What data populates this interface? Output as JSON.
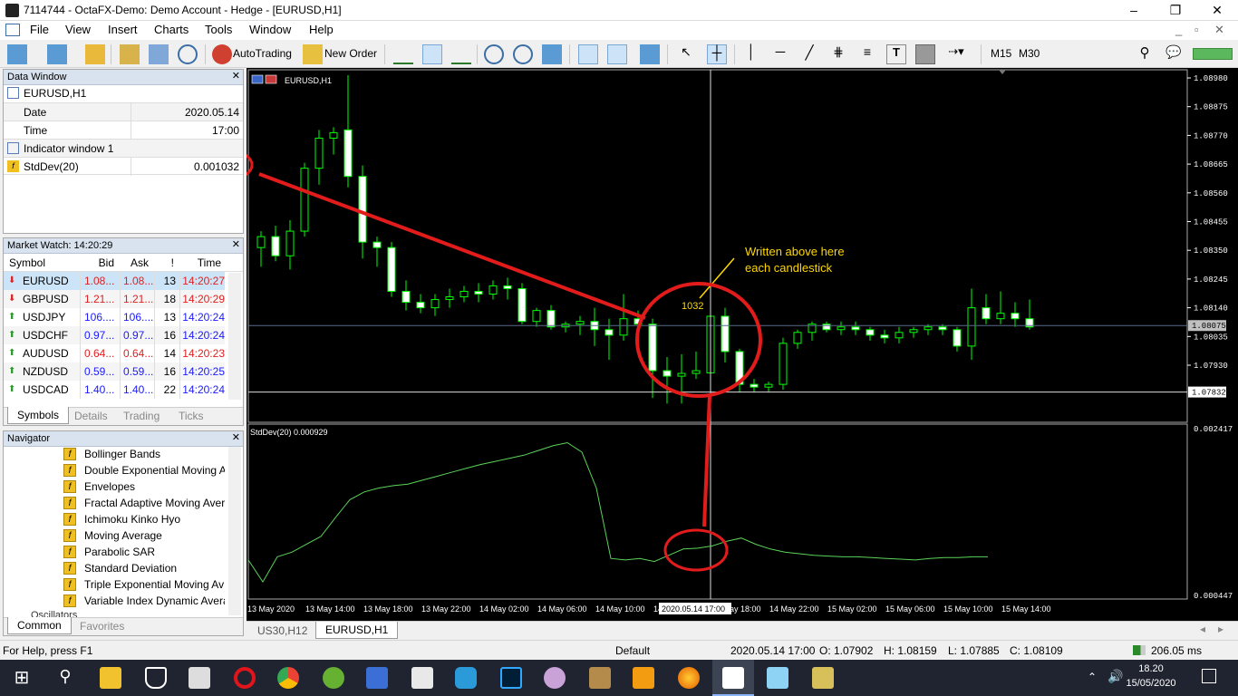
{
  "window": {
    "title": "7114744 - OctaFX-Demo: Demo Account - Hedge - [EURUSD,H1]",
    "min": "–",
    "max": "❐",
    "close": "✕"
  },
  "menu": [
    "File",
    "View",
    "Insert",
    "Charts",
    "Tools",
    "Window",
    "Help"
  ],
  "toolbar": {
    "autotrading": "AutoTrading",
    "new_order": "New Order",
    "m15": "M15",
    "m30": "M30"
  },
  "data_window": {
    "title": "Data Window",
    "symbol": "EURUSD,H1",
    "rows": [
      {
        "label": "Date",
        "value": "2020.05.14"
      },
      {
        "label": "Time",
        "value": "17:00"
      }
    ],
    "indicator_window": "Indicator window 1",
    "indicator": {
      "label": "StdDev(20)",
      "value": "0.001032"
    }
  },
  "market_watch": {
    "title": "Market Watch: 14:20:29",
    "headers": [
      "Symbol",
      "Bid",
      "Ask",
      "!",
      "Time"
    ],
    "rows": [
      {
        "symbol": "EURUSD",
        "bid": "1.08...",
        "ask": "1.08...",
        "spread": "13",
        "time": "14:20:27",
        "dir": "down",
        "color": "#e02020"
      },
      {
        "symbol": "GBPUSD",
        "bid": "1.21...",
        "ask": "1.21...",
        "spread": "18",
        "time": "14:20:29",
        "dir": "down",
        "color": "#e02020"
      },
      {
        "symbol": "USDJPY",
        "bid": "106....",
        "ask": "106....",
        "spread": "13",
        "time": "14:20:24",
        "dir": "up",
        "color": "#1a1aff"
      },
      {
        "symbol": "USDCHF",
        "bid": "0.97...",
        "ask": "0.97...",
        "spread": "16",
        "time": "14:20:24",
        "dir": "up",
        "color": "#1a1aff"
      },
      {
        "symbol": "AUDUSD",
        "bid": "0.64...",
        "ask": "0.64...",
        "spread": "14",
        "time": "14:20:23",
        "dir": "up",
        "color": "#e02020"
      },
      {
        "symbol": "NZDUSD",
        "bid": "0.59...",
        "ask": "0.59...",
        "spread": "16",
        "time": "14:20:25",
        "dir": "up",
        "color": "#1a1aff"
      },
      {
        "symbol": "USDCAD",
        "bid": "1.40...",
        "ask": "1.40...",
        "spread": "22",
        "time": "14:20:24",
        "dir": "up",
        "color": "#1a1aff"
      }
    ],
    "tabs": [
      "Symbols",
      "Details",
      "Trading",
      "Ticks"
    ]
  },
  "navigator": {
    "title": "Navigator",
    "items": [
      "Bollinger Bands",
      "Double Exponential Moving A",
      "Envelopes",
      "Fractal Adaptive Moving Aver",
      "Ichimoku Kinko Hyo",
      "Moving Average",
      "Parabolic SAR",
      "Standard Deviation",
      "Triple Exponential Moving Av",
      "Variable Index Dynamic Avera"
    ],
    "partial_item": "Oscillators",
    "tabs": [
      "Common",
      "Favorites"
    ]
  },
  "chart": {
    "symbol_label": "EURUSD,H1",
    "indicator_label": "StdDev(20) 0.000929",
    "price_ticks": [
      "1.08980",
      "1.08875",
      "1.08770",
      "1.08665",
      "1.08560",
      "1.08455",
      "1.08350",
      "1.08245",
      "1.08140",
      "1.08035",
      "1.07930"
    ],
    "current_price": "1.08075",
    "crosshair_price": "1.07832",
    "ind_ticks": [
      "0.002417",
      "0.000447"
    ],
    "time_ticks": [
      "13 May 2020",
      "13 May 14:00",
      "13 May 18:00",
      "13 May 22:00",
      "14 May 02:00",
      "14 May 06:00",
      "14 May 10:00",
      "14 May 14:00",
      "14 May 18:00",
      "14 May 22:00",
      "15 May 02:00",
      "15 May 06:00",
      "15 May 10:00",
      "15 May 14:00"
    ],
    "crosshair_time": "2020.05.14 17:00",
    "candle_label": "1032",
    "annotation": [
      "Written above here",
      "each candlestick"
    ],
    "colors": {
      "bull": "#ffffff",
      "wick": "#00ff00",
      "indicator": "#5ad35a",
      "annot_text": "#ffd700",
      "annot_circle": "#e21b1b"
    }
  },
  "chart_tabs": [
    "US30,H12",
    "EURUSD,H1"
  ],
  "status": {
    "help": "For Help, press F1",
    "profile": "Default",
    "datetime": "2020.05.14 17:00",
    "open": "O: 1.07902",
    "high": "H: 1.08159",
    "low": "L: 1.07885",
    "close": "C: 1.08109",
    "ping": "206.05 ms"
  },
  "clock": {
    "time": "18.20",
    "date": "15/05/2020"
  }
}
